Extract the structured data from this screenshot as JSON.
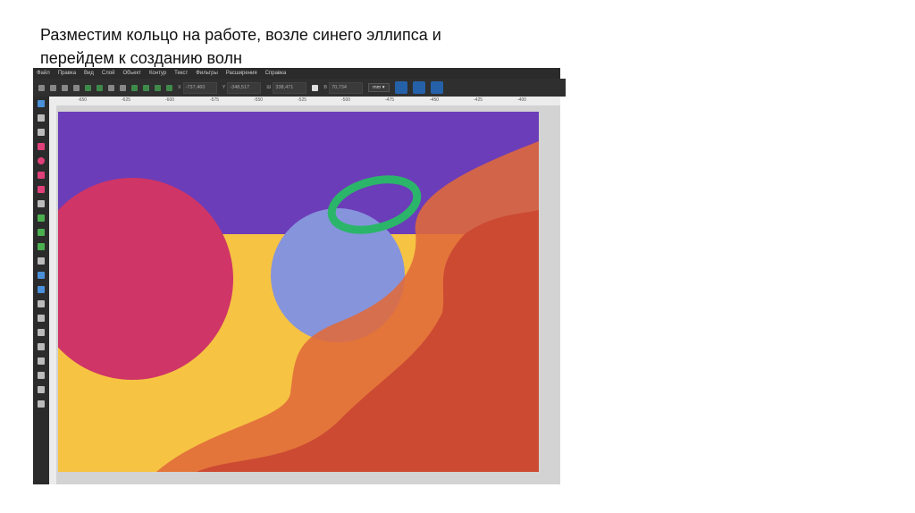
{
  "title_lines": [
    "Разместим кольцо на работе, возле синего эллипса и",
    "перейдем к созданию волн"
  ],
  "menu": [
    "Файл",
    "Правка",
    "Вид",
    "Слой",
    "Объект",
    "Контур",
    "Текст",
    "Фильтры",
    "Расширения",
    "Справка"
  ],
  "fields": {
    "x_label": "X",
    "x": "-737,460",
    "y_label": "Y",
    "y": "-348,517",
    "w_label": "Ш",
    "w": "338,471",
    "h_label": "В",
    "h": "70,734",
    "unit": "mm ▾"
  },
  "ruler": [
    "-650",
    "-625",
    "-600",
    "-575",
    "-550",
    "-525",
    "-500",
    "-475",
    "-450",
    "-425",
    "-400"
  ],
  "colors": {
    "purple": "#6c3db8",
    "yellow": "#f6c343",
    "pink": "#cf3566",
    "blue": "#8694dc",
    "green": "#2bb56a",
    "orange": "#e06a3a",
    "red": "#cc4a32"
  }
}
